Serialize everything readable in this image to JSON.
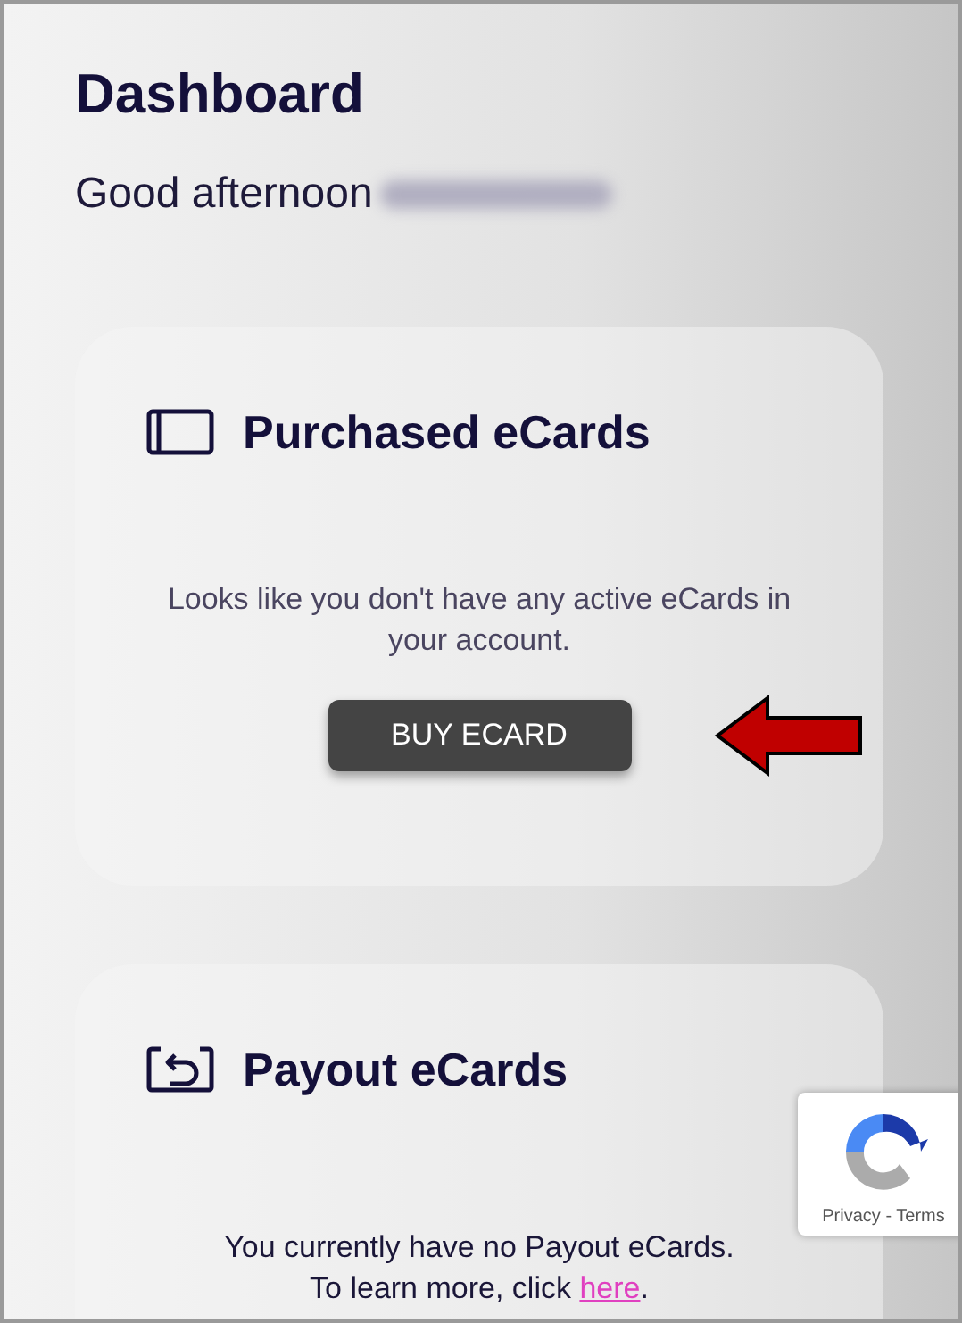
{
  "header": {
    "title": "Dashboard",
    "greeting": "Good afternoon"
  },
  "cards": [
    {
      "kind": "purchased",
      "title": "Purchased eCards",
      "message": "Looks like you don't have any active eCards in your account.",
      "button": "BUY ECARD"
    },
    {
      "kind": "payout",
      "title": "Payout eCards",
      "message": "You currently have no Payout eCards.",
      "message_2": "To learn more, click",
      "link": "here",
      "message_end": "."
    }
  ],
  "recaptcha": {
    "links": "Privacy - Terms"
  }
}
